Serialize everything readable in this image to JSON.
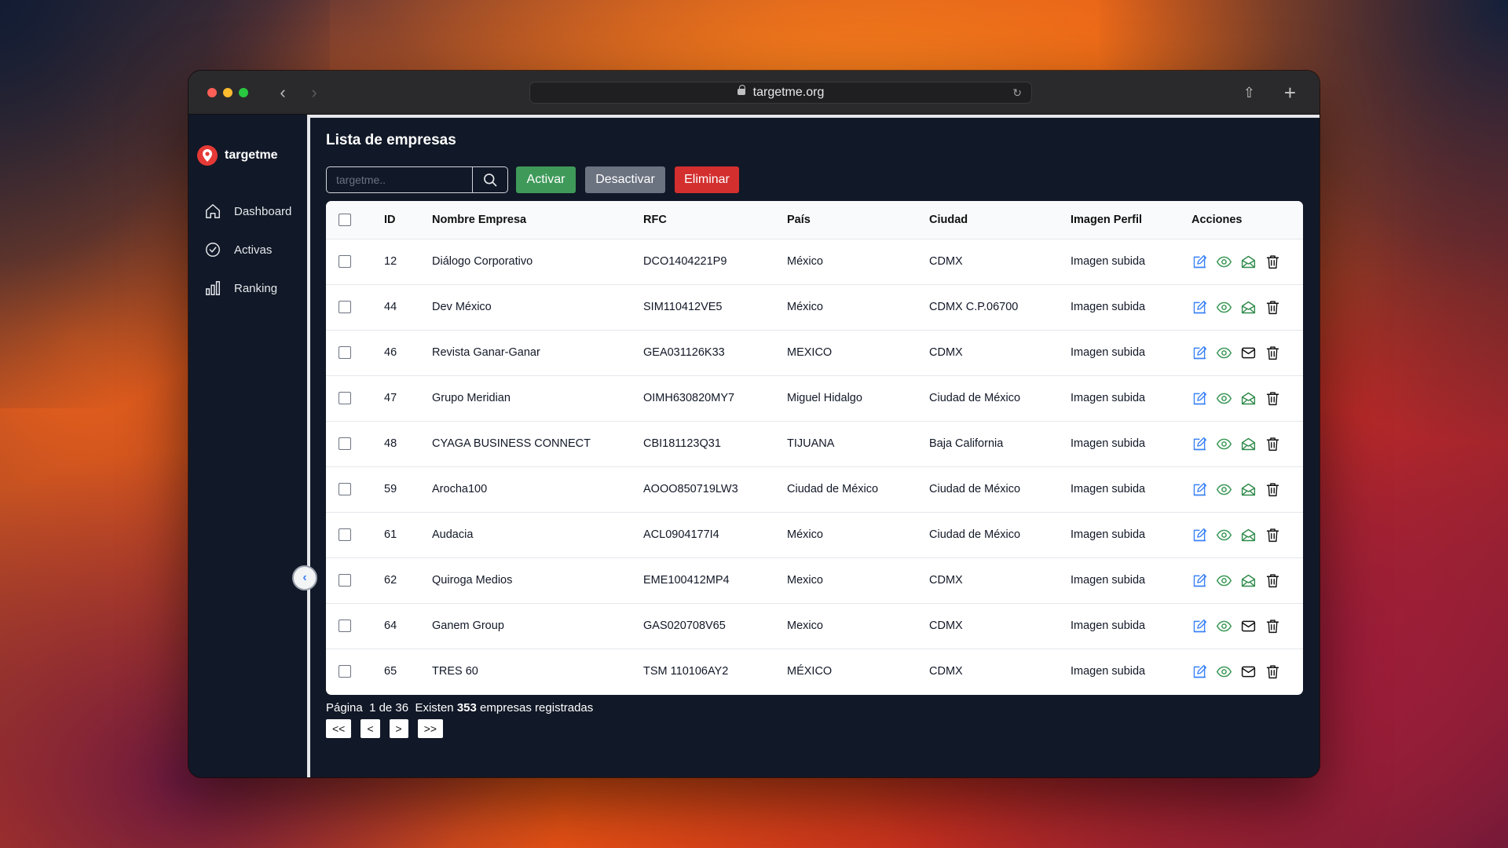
{
  "browser": {
    "url": "targetme.org"
  },
  "sidebar": {
    "brand": "targetme",
    "items": [
      {
        "label": "Dashboard",
        "icon": "home-icon"
      },
      {
        "label": "Activas",
        "icon": "check-circle-icon"
      },
      {
        "label": "Ranking",
        "icon": "bar-chart-icon"
      }
    ]
  },
  "main": {
    "title": "Lista de empresas",
    "search_placeholder": "targetme..",
    "buttons": {
      "activar": "Activar",
      "desactivar": "Desactivar",
      "eliminar": "Eliminar"
    },
    "columns": [
      "ID",
      "Nombre Empresa",
      "RFC",
      "País",
      "Ciudad",
      "Imagen Perfil",
      "Acciones"
    ],
    "rows": [
      {
        "id": "12",
        "nombre": "Diálogo Corporativo",
        "rfc": "DCO1404221P9",
        "pais": "México",
        "ciudad": "CDMX",
        "imagen": "Imagen subida",
        "mail": "open"
      },
      {
        "id": "44",
        "nombre": "Dev México",
        "rfc": "SIM110412VE5",
        "pais": "México",
        "ciudad": "CDMX C.P.06700",
        "imagen": "Imagen subida",
        "mail": "open"
      },
      {
        "id": "46",
        "nombre": "Revista Ganar-Ganar",
        "rfc": "GEA031126K33",
        "pais": "MEXICO",
        "ciudad": "CDMX",
        "imagen": "Imagen subida",
        "mail": "closed"
      },
      {
        "id": "47",
        "nombre": "Grupo Meridian",
        "rfc": "OIMH630820MY7",
        "pais": "Miguel Hidalgo",
        "ciudad": "Ciudad de México",
        "imagen": "Imagen subida",
        "mail": "open"
      },
      {
        "id": "48",
        "nombre": "CYAGA BUSINESS CONNECT",
        "rfc": "CBI181123Q31",
        "pais": "TIJUANA",
        "ciudad": "Baja California",
        "imagen": "Imagen subida",
        "mail": "open"
      },
      {
        "id": "59",
        "nombre": "Arocha100",
        "rfc": "AOOO850719LW3",
        "pais": "Ciudad de México",
        "ciudad": "Ciudad de México",
        "imagen": "Imagen subida",
        "mail": "open"
      },
      {
        "id": "61",
        "nombre": "Audacia",
        "rfc": "ACL0904177I4",
        "pais": "México",
        "ciudad": "Ciudad de México",
        "imagen": "Imagen subida",
        "mail": "open"
      },
      {
        "id": "62",
        "nombre": "Quiroga Medios",
        "rfc": "EME100412MP4",
        "pais": "Mexico",
        "ciudad": "CDMX",
        "imagen": "Imagen subida",
        "mail": "open"
      },
      {
        "id": "64",
        "nombre": "Ganem Group",
        "rfc": "GAS020708V65",
        "pais": "Mexico",
        "ciudad": "CDMX",
        "imagen": "Imagen subida",
        "mail": "closed"
      },
      {
        "id": "65",
        "nombre": "TRES 60",
        "rfc": "TSM 110106AY2",
        "pais": "MÉXICO",
        "ciudad": "CDMX",
        "imagen": "Imagen subida",
        "mail": "closed"
      }
    ],
    "pagination": {
      "pagina_label": "Página",
      "pagina_value": "1 de 36",
      "existen_label": "Existen",
      "total": "353",
      "suffix": "empresas registradas",
      "buttons": [
        "<<",
        "<",
        ">",
        ">>"
      ]
    }
  },
  "colors": {
    "activar": "#3f9a5a",
    "desactivar": "#6b7280",
    "eliminar": "#d32f2f",
    "edit_icon": "#3b82f6",
    "view_icon": "#3f9a5a",
    "mail_open_icon": "#2f8a4a",
    "mail_closed_icon": "#111111",
    "brand_pin": "#e53935"
  }
}
